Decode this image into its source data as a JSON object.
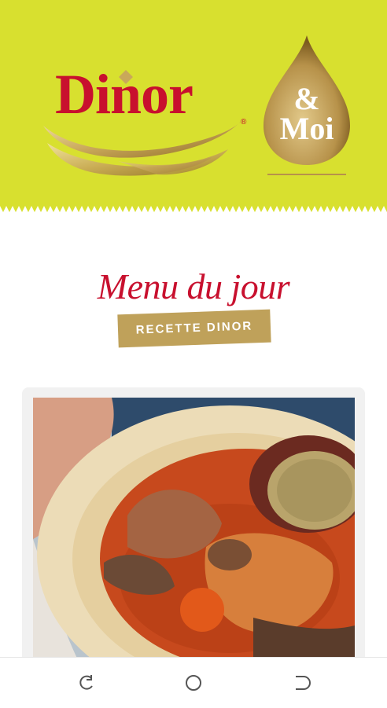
{
  "header": {
    "brand": "Dinor",
    "registered_mark": "®",
    "drop_ampersand": "&",
    "drop_word": "Moi"
  },
  "content": {
    "menu_title": "Menu du jour",
    "badge": "RECETTE DINOR"
  },
  "card": {
    "image_icon": "fish-stew-photo"
  },
  "navbar": {
    "back_icon": "rotate-left-icon",
    "home_icon": "home-circle-icon",
    "recents_icon": "recents-icon"
  },
  "colors": {
    "header_bg": "#d8e02f",
    "brand_red": "#c8102e",
    "gold": "#bfa15a"
  }
}
